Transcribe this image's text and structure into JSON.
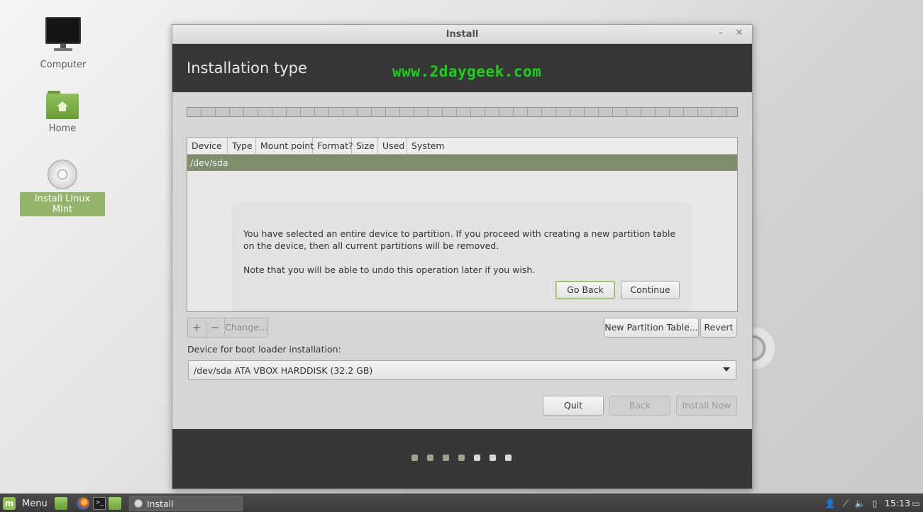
{
  "desktop": {
    "icons": [
      {
        "label": "Computer"
      },
      {
        "label": "Home"
      },
      {
        "label": "Install Linux Mint"
      }
    ]
  },
  "window": {
    "title": "Install",
    "minimize_glyph": "–",
    "close_glyph": "✕"
  },
  "header": {
    "title": "Installation type",
    "watermark": "www.2daygeek.com"
  },
  "table": {
    "columns": [
      "Device",
      "Type",
      "Mount point",
      "Format?",
      "Size",
      "Used",
      "System"
    ],
    "rows": [
      "/dev/sda"
    ]
  },
  "dialog": {
    "message": "You have selected an entire device to partition. If you proceed with creating a new partition table on the device, then all current partitions will be removed.",
    "note": "Note that you will be able to undo this operation later if you wish.",
    "go_back": "Go Back",
    "continue": "Continue"
  },
  "toolbar": {
    "add": "+",
    "remove": "−",
    "change": "Change...",
    "new_partition_table": "New Partition Table...",
    "revert": "Revert"
  },
  "bootloader": {
    "label": "Device for boot loader installation:",
    "selected": "/dev/sda ATA VBOX HARDDISK (32.2 GB)"
  },
  "actions": {
    "quit": "Quit",
    "back": "Back",
    "install_now": "Install Now"
  },
  "progress": {
    "total_steps": 7,
    "completed_steps": 4
  },
  "taskbar": {
    "menu": "Menu",
    "task": "Install",
    "clock": "15:13"
  }
}
